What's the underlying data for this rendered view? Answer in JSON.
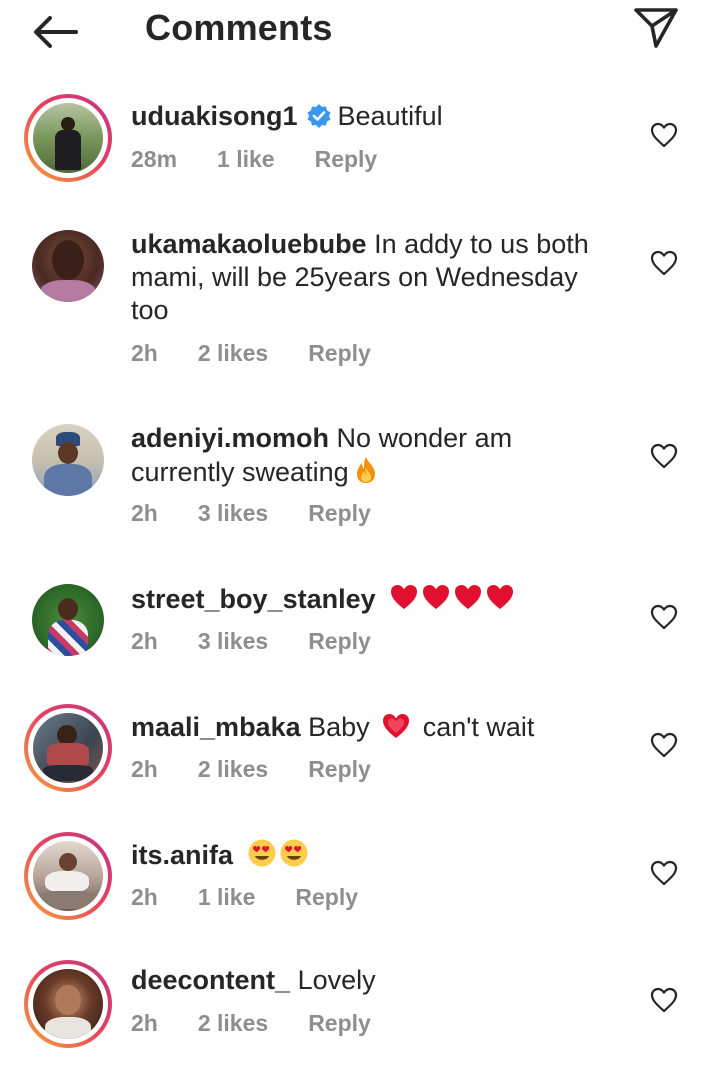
{
  "header": {
    "title": "Comments"
  },
  "colors": {
    "verified": "#3897f0",
    "meta": "#8e8e8e",
    "text": "#262626",
    "heart_emoji": "#e0102e"
  },
  "comments": [
    {
      "username": "uduakisong1",
      "verified": true,
      "text": "Beautiful",
      "time": "28m",
      "likes": "1 like",
      "reply": "Reply",
      "story_ring": true
    },
    {
      "username": "ukamakaoluebube",
      "verified": false,
      "text": "In addy to us both mami, will be 25years on Wednesday too",
      "time": "2h",
      "likes": "2 likes",
      "reply": "Reply",
      "story_ring": false
    },
    {
      "username": "adeniyi.momoh",
      "verified": false,
      "text": "No wonder am currently sweating",
      "emoji": "fire-emoji",
      "time": "2h",
      "likes": "3 likes",
      "reply": "Reply",
      "story_ring": false
    },
    {
      "username": "street_boy_stanley",
      "verified": false,
      "text": "",
      "emoji": "red-heart-emoji x4",
      "time": "2h",
      "likes": "3 likes",
      "reply": "Reply",
      "story_ring": false
    },
    {
      "username": "maali_mbaka",
      "verified": false,
      "text_before": "Baby",
      "emoji": "growing-heart-emoji",
      "text_after": "can't wait",
      "time": "2h",
      "likes": "2 likes",
      "reply": "Reply",
      "story_ring": true
    },
    {
      "username": "its.anifa",
      "verified": false,
      "text": "",
      "emoji": "heart-eyes-emoji x2",
      "time": "2h",
      "likes": "1 like",
      "reply": "Reply",
      "story_ring": true
    },
    {
      "username": "deecontent_",
      "verified": false,
      "text": "Lovely",
      "time": "2h",
      "likes": "2 likes",
      "reply": "Reply",
      "story_ring": true
    }
  ]
}
